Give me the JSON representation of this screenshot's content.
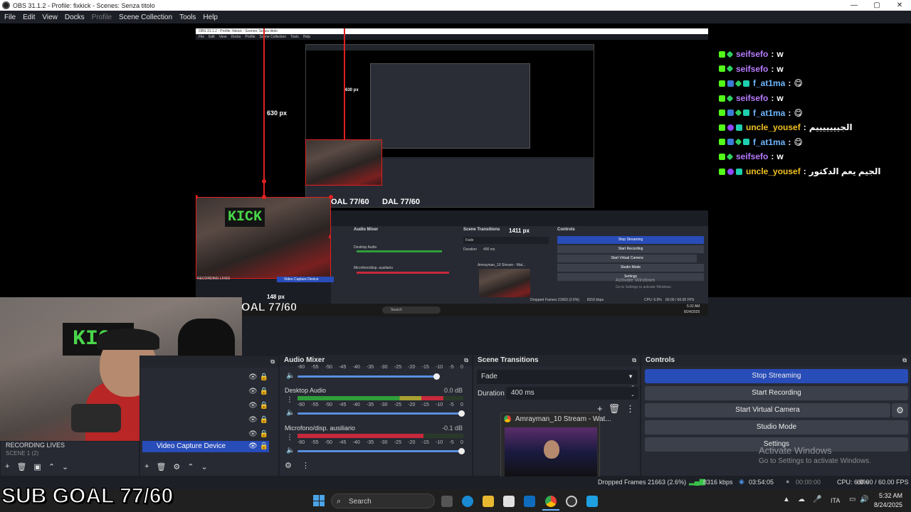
{
  "window": {
    "title": "OBS 31.1.2 - Profile: fixkick - Scenes: Senza titolo",
    "minimize": "—",
    "maximize": "▢",
    "close": "✕"
  },
  "menu": {
    "items": [
      "File",
      "Edit",
      "View",
      "Docks",
      "Profile",
      "Scene Collection",
      "Tools",
      "Help"
    ]
  },
  "preview": {
    "nested_title": "OBS 31.1.2 - Profile: fixkick - Scenes: Senza titolo",
    "nested_menu": [
      "File",
      "Edit",
      "View",
      "Docks",
      "Profile",
      "Scene Collection",
      "Tools",
      "Help"
    ],
    "dim_630": "630 px",
    "dim_630_small": "630 px",
    "dim_1411": "1411 px",
    "dim_148": "148 px",
    "subgoal_nested": "OAL 77/60",
    "subgoal_nested_small": "DAL 77/60",
    "nested_audio_title": "Audio Mixer",
    "nested_transitions_title": "Scene Transitions",
    "nested_controls_title": "Controls",
    "nested_desktop_audio": "Desktop Audio",
    "nested_mic": "Microfono/disp. ausiliario",
    "nested_fade": "Fade",
    "nested_duration": "Duration",
    "nested_duration_value": "400 ms",
    "nested_controls": [
      "Stop Streaming",
      "Start Recording",
      "Start Virtual Camera",
      "Studio Mode",
      "Settings"
    ],
    "nested_recording_lives": "RECORDING LIVES",
    "nested_video_capture": "Video Capture Device",
    "nested_stream_thumb": "Amrayman_10 Stream - Wat...",
    "nested_dropped": "Dropped Frames 21663 (2.6%)",
    "nested_kbps": "8316 kbps",
    "nested_activate": "Activate Windows",
    "nested_activate_sub": "Go to Settings to activate Windows.",
    "nested_search": "Search",
    "nested_time": "5:32 AM",
    "nested_date": "8/24/2025",
    "nested_cpu": "CPU: 6.9%",
    "nested_fps": "60.00 / 60.00 FPS",
    "nested_kick": "KICK"
  },
  "chat": {
    "messages": [
      {
        "user": "seifsefo",
        "color": "#b77cff",
        "badges": [
          "k",
          "g"
        ],
        "text": "w"
      },
      {
        "user": "seifsefo",
        "color": "#b77cff",
        "badges": [
          "k",
          "g"
        ],
        "text": "w"
      },
      {
        "user": "f_at1ma",
        "color": "#6fb6ff",
        "badges": [
          "k",
          "b",
          "g",
          "t"
        ],
        "text": "😋"
      },
      {
        "user": "seifsefo",
        "color": "#b77cff",
        "badges": [
          "k",
          "g"
        ],
        "text": "w"
      },
      {
        "user": "f_at1ma",
        "color": "#6fb6ff",
        "badges": [
          "k",
          "b",
          "g",
          "t"
        ],
        "text": "😋"
      },
      {
        "user": "uncle_yousef",
        "color": "#f0c020",
        "badges": [
          "k",
          "p",
          "t"
        ],
        "text": "الجيييييييم"
      },
      {
        "user": "f_at1ma",
        "color": "#6fb6ff",
        "badges": [
          "k",
          "b",
          "g",
          "t"
        ],
        "text": "😋"
      },
      {
        "user": "seifsefo",
        "color": "#b77cff",
        "badges": [
          "k",
          "g"
        ],
        "text": "w"
      },
      {
        "user": "uncle_yousef",
        "color": "#f0c020",
        "badges": [
          "k",
          "p",
          "t"
        ],
        "text": "الجيم يعم الدكتور"
      }
    ],
    "separator": ":"
  },
  "scenes": {
    "recording_lives": "RECORDING LIVES",
    "scene_partial": "SCENE 1 (2)"
  },
  "sources": {
    "selected": "Video Capture Device"
  },
  "audio": {
    "title": "Audio Mixer",
    "scale": [
      "-60",
      "-55",
      "-50",
      "-45",
      "-40",
      "-35",
      "-30",
      "-25",
      "-20",
      "-15",
      "-10",
      "-5",
      "0"
    ],
    "channels": [
      {
        "name": "Desktop Audio",
        "db": "0.0 dB",
        "level": 0.88,
        "volume": 1.0
      },
      {
        "name": "Microfono/disp. ausiliario",
        "db": "-0.1 dB",
        "level": 0.76,
        "volume": 1.0
      }
    ],
    "top_volume": 0.85
  },
  "transitions": {
    "title": "Scene Transitions",
    "selected": "Fade",
    "duration_label": "Duration",
    "duration_value": "400 ms"
  },
  "controls": {
    "title": "Controls",
    "buttons": [
      "Stop Streaming",
      "Start Recording",
      "Start Virtual Camera",
      "Studio Mode",
      "Settings"
    ]
  },
  "thumbnail": {
    "label": "Amrayman_10 Stream - Wat..."
  },
  "status": {
    "dropped": "Dropped Frames 21663 (2.6%)",
    "kbps": "8316 kbps",
    "stream_time": "03:54:05",
    "rec_time": "00:00:00",
    "cpu": "CPU: 6.9%",
    "fps": "60.00 / 60.00 FPS"
  },
  "watermark": {
    "title": "Activate Windows",
    "subtitle": "Go to Settings to activate Windows."
  },
  "taskbar": {
    "search_placeholder": "Search",
    "language": "ITA",
    "time": "5:32 AM",
    "date": "8/24/2025"
  },
  "overlay": {
    "subgoal": "SUB GOAL 77/60",
    "kick": "KICK"
  },
  "colors": {
    "accent": "#284cb8",
    "kick_green": "#53fc18",
    "selection_red": "#e02020",
    "meter_green": "#2f9e3a",
    "meter_red": "#c8283c"
  }
}
